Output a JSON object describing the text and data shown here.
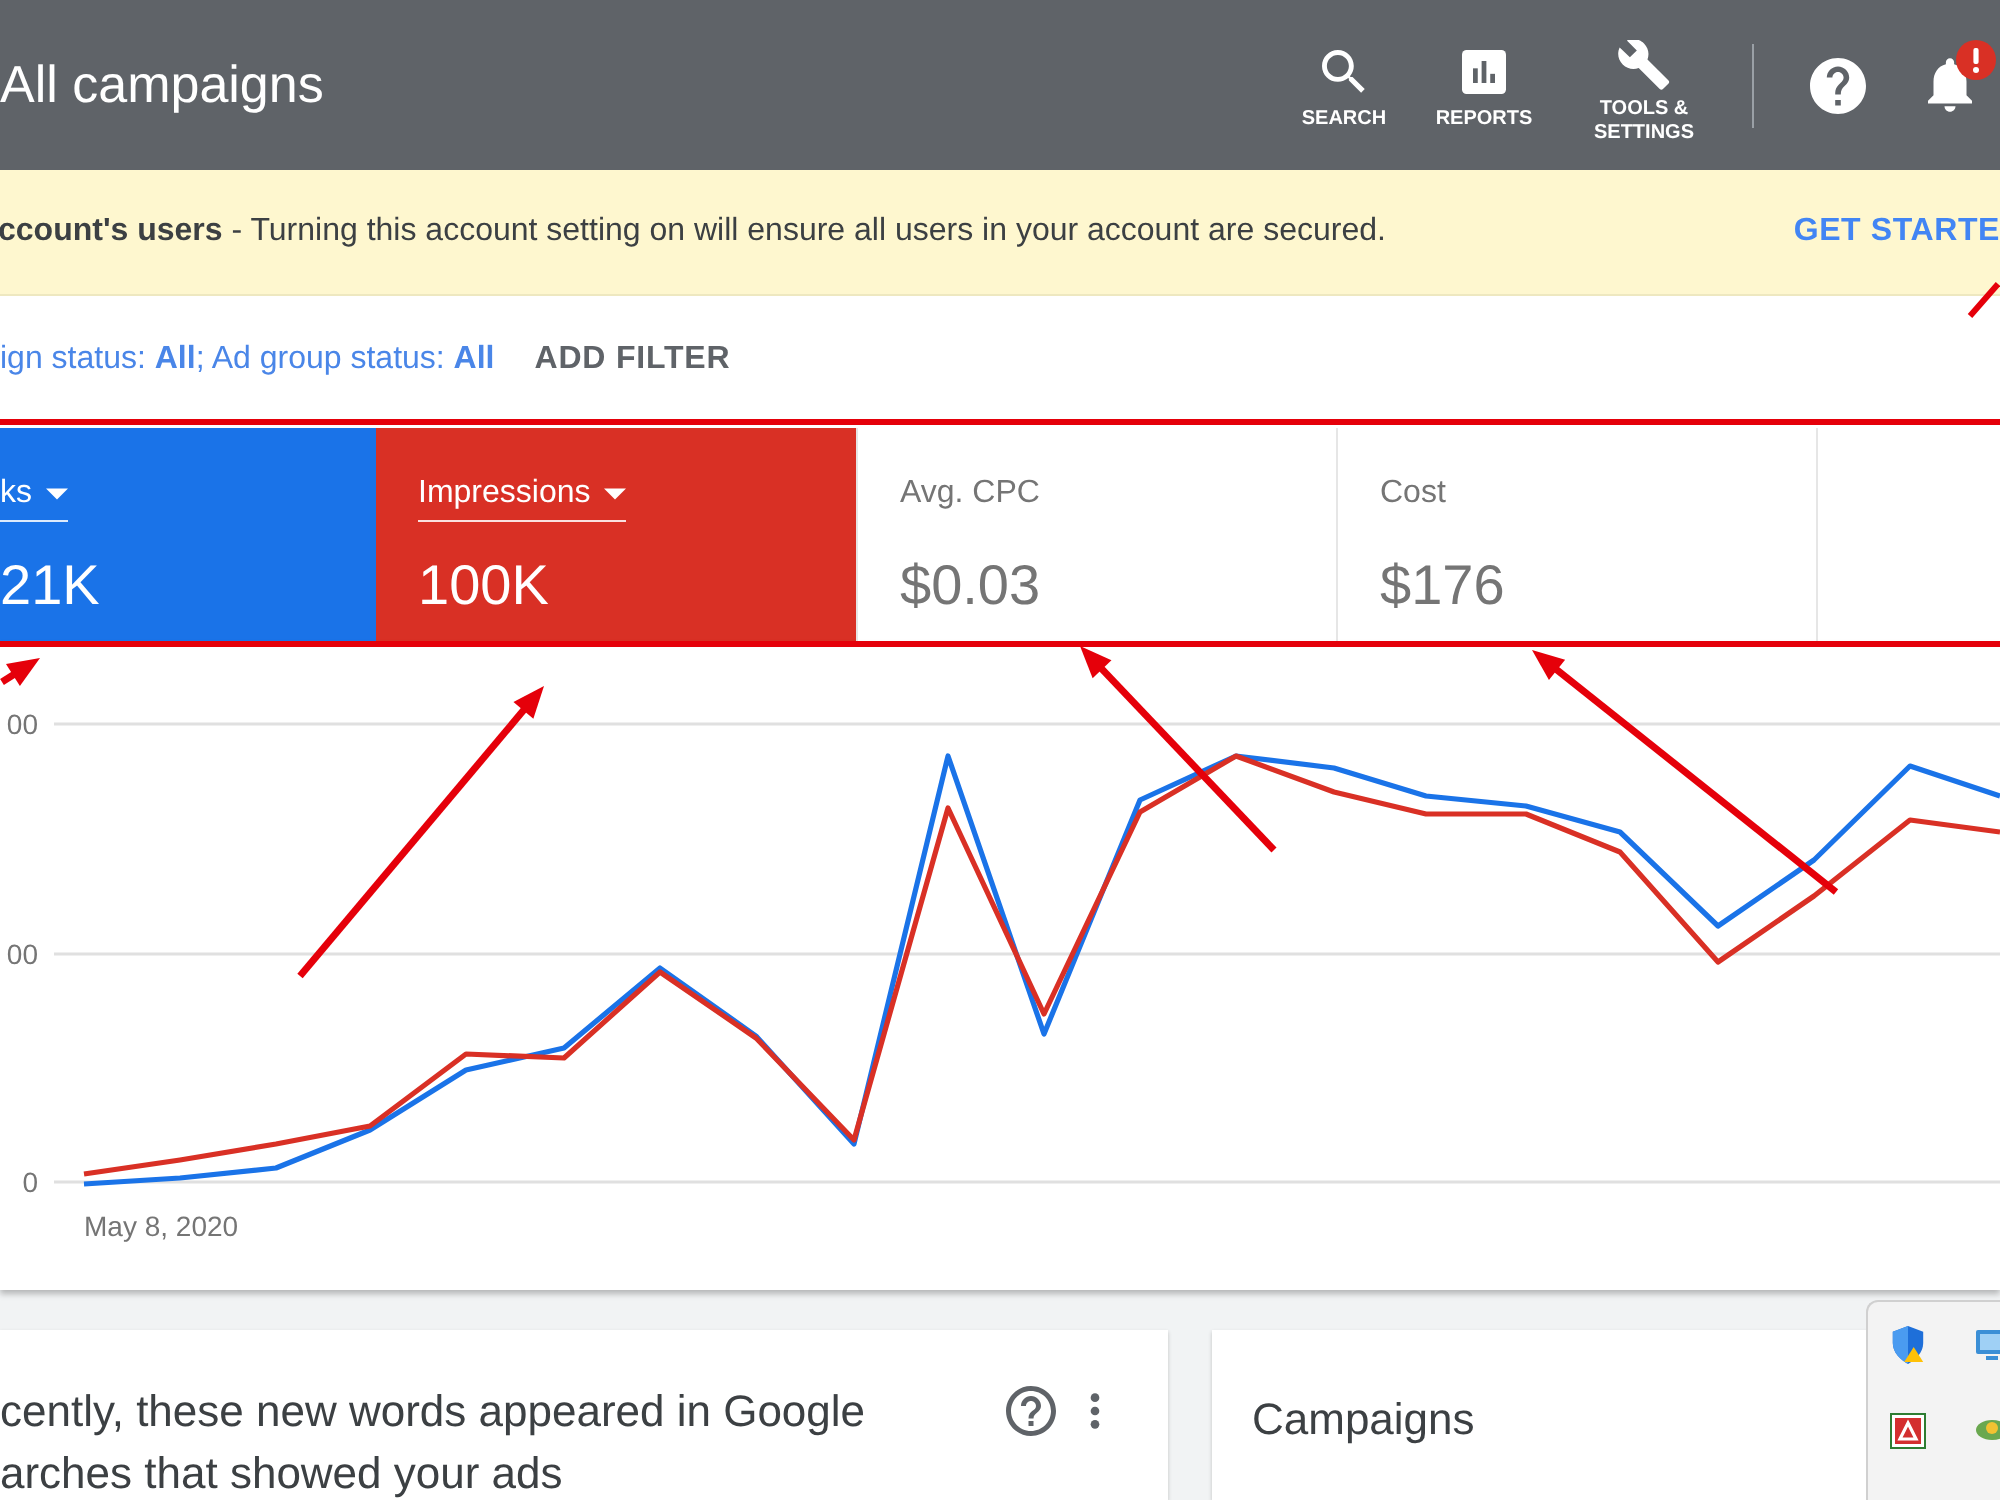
{
  "header": {
    "title": "All campaigns",
    "actions": [
      {
        "kind": "search",
        "label": "SEARCH"
      },
      {
        "kind": "reports",
        "label": "REPORTS"
      },
      {
        "kind": "tools",
        "label": "TOOLS & SETTINGS"
      }
    ],
    "notifications": {
      "alert": true
    }
  },
  "banner": {
    "text": "**ccount's users** - Turning this account setting on will ensure all users in your account are secured.",
    "action": "GET STARTE"
  },
  "filters": {
    "text": "ign status: **All**; Ad group status: **All**",
    "action": "ADD FILTER"
  },
  "metrics": [
    {
      "label": "ks",
      "value": "21K",
      "selected": true,
      "color": "#1a73e8"
    },
    {
      "label": "Impressions",
      "value": "100K",
      "selected": true,
      "color": "#d93025"
    },
    {
      "label": "Avg. CPC",
      "value": "$0.03",
      "selected": false
    },
    {
      "label": "Cost",
      "value": "$176",
      "selected": false
    }
  ],
  "chart": {
    "y_labels": [
      "00",
      "00",
      "0"
    ],
    "x_label": "May 8, 2020"
  },
  "cards": [
    {
      "kind": "insight",
      "title": "cently, these new words appeared in Google arches that showed your ads"
    },
    {
      "kind": "summary",
      "title": "Campaigns"
    }
  ]
}
